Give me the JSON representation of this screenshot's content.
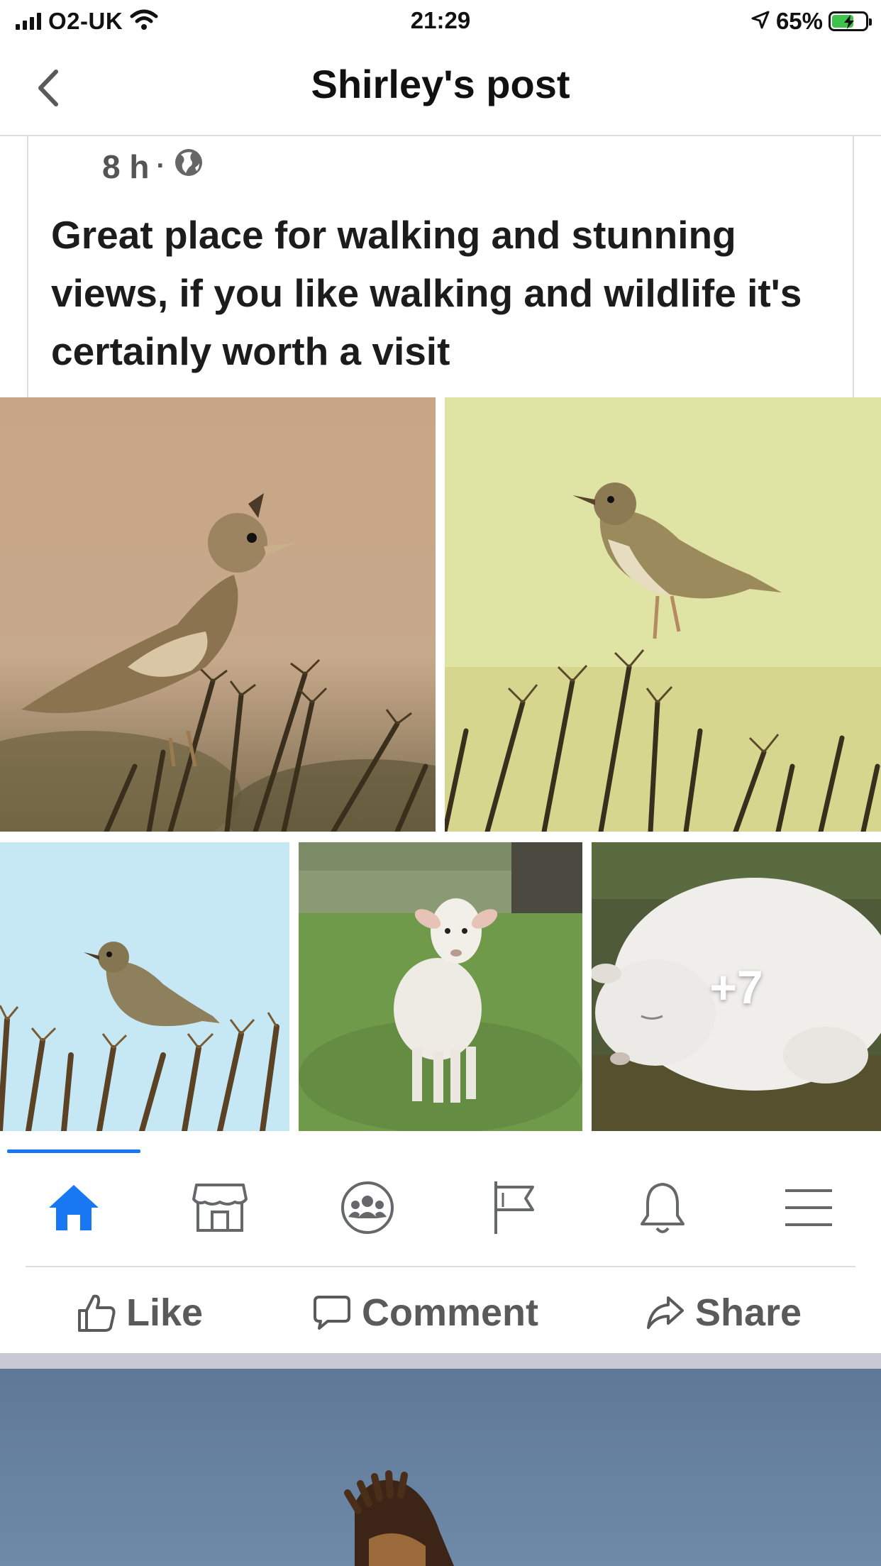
{
  "status_bar": {
    "carrier": "O2-UK",
    "time": "21:29",
    "battery_percent": "65%",
    "battery_level": 0.65,
    "icons": [
      "signal-icon",
      "wifi-icon",
      "location-arrow-icon",
      "battery-charging-icon"
    ]
  },
  "header": {
    "title": "Shirley's post",
    "back_icon": "chevron-left-icon"
  },
  "post": {
    "time_ago": "8 h",
    "separator": "·",
    "audience_icon": "globe-icon",
    "text": "Great place for walking and stunning views, if you like walking and wildlife it's certainly worth a visit",
    "photos": [
      {
        "subject": "skylark on gorse"
      },
      {
        "subject": "meadow pipit on gorse"
      },
      {
        "subject": "pipit on gorse against sky"
      },
      {
        "subject": "white lamb standing in field"
      },
      {
        "subject": "sleeping lamb",
        "overlay": "+7"
      }
    ]
  },
  "tabbar": {
    "active_index": 0,
    "tabs": [
      {
        "icon": "home-icon",
        "active": true
      },
      {
        "icon": "marketplace-icon",
        "active": false
      },
      {
        "icon": "groups-icon",
        "active": false
      },
      {
        "icon": "pages-flag-icon",
        "active": false
      },
      {
        "icon": "notifications-bell-icon",
        "active": false
      },
      {
        "icon": "menu-icon",
        "active": false
      }
    ],
    "colors": {
      "active": "#1877f2",
      "inactive": "#65676b"
    }
  },
  "actions": {
    "like": "Like",
    "comment": "Comment",
    "share": "Share"
  }
}
